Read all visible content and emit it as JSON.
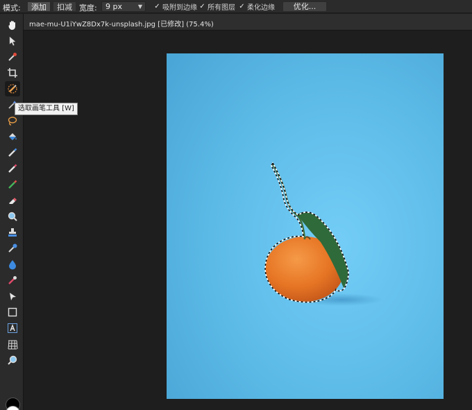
{
  "context_bar": {
    "mode_label": "模式:",
    "mode_add": "添加",
    "mode_subtract": "扣减",
    "width_label": "宽度:",
    "width_value": "9 px",
    "snap_edges": "吸附到边缘",
    "all_layers": "所有图层",
    "soften_edges": "柔化边缘",
    "refine_button": "优化..."
  },
  "document": {
    "title": "mae-mu-U1iYwZ8Dx7k-unsplash.jpg [已修改] (75.4%)"
  },
  "tooltip": {
    "text": "选取画笔工具 [W]"
  },
  "tools": [
    {
      "icon": "hand-icon",
      "active": false
    },
    {
      "icon": "move-pointer-icon",
      "active": false
    },
    {
      "icon": "color-picker-icon",
      "active": false
    },
    {
      "icon": "crop-icon",
      "active": false
    },
    {
      "icon": "selection-brush-icon",
      "active": true
    },
    {
      "icon": "magic-wand-icon",
      "active": false
    },
    {
      "icon": "freehand-selection-icon",
      "active": false
    },
    {
      "icon": "flood-fill-icon",
      "active": false
    },
    {
      "icon": "paint-brush-icon",
      "active": false
    },
    {
      "icon": "pixel-brush-icon",
      "active": false
    },
    {
      "icon": "clone-brush-icon",
      "active": false
    },
    {
      "icon": "eraser-icon",
      "active": false
    },
    {
      "icon": "magnify-icon",
      "active": false
    },
    {
      "icon": "stamp-icon",
      "active": false
    },
    {
      "icon": "dodge-burn-icon",
      "active": false
    },
    {
      "icon": "blur-drop-icon",
      "active": false
    },
    {
      "icon": "smudge-icon",
      "active": false
    },
    {
      "icon": "node-pointer-icon",
      "active": false
    },
    {
      "icon": "rectangle-shape-icon",
      "active": false
    },
    {
      "icon": "text-tool-icon",
      "active": false
    },
    {
      "icon": "mesh-warp-icon",
      "active": false
    },
    {
      "icon": "zoom-icon",
      "active": false
    }
  ],
  "colors": {
    "foreground": "#000000",
    "background": "#ffffff",
    "photo_backdrop": "#5fbde8",
    "orange": "#e87a2a"
  }
}
